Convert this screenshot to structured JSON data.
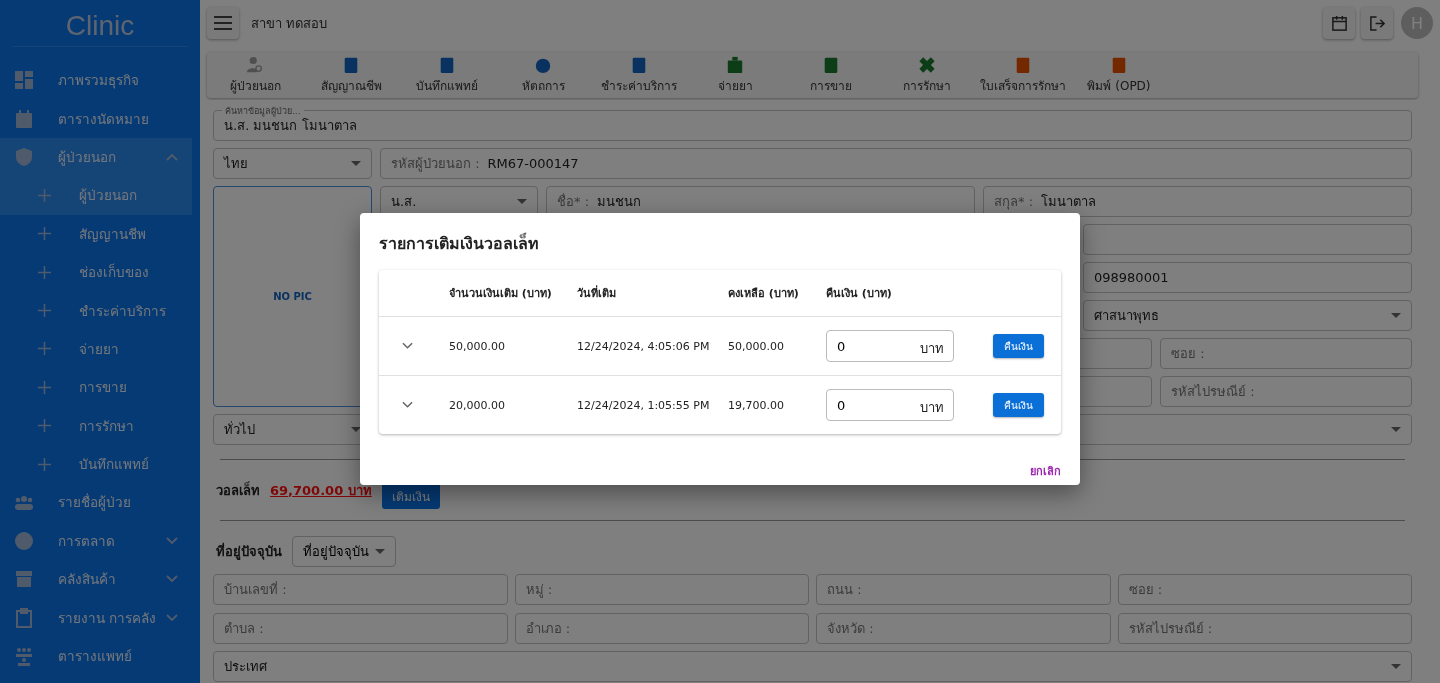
{
  "sidebar": {
    "title": "Clinic",
    "items": [
      {
        "label": "ภาพรวมธุรกิจ",
        "selected": false
      },
      {
        "label": "ตารางนัดหมาย",
        "selected": false
      },
      {
        "label": "ผู้ป่วยนอก",
        "selected": true,
        "expanded": true,
        "children": [
          {
            "label": "ผู้ป่วยนอก",
            "selected": true
          },
          {
            "label": "สัญญานชีพ",
            "selected": false
          },
          {
            "label": "ช่องเก็บของ",
            "selected": false
          },
          {
            "label": "ชำระค่าบริการ",
            "selected": false
          },
          {
            "label": "จ่ายยา",
            "selected": false
          },
          {
            "label": "การขาย",
            "selected": false
          },
          {
            "label": "การรักษา",
            "selected": false
          },
          {
            "label": "บันทึกแพทย์",
            "selected": false
          }
        ]
      },
      {
        "label": "รายชื่อผู้ป่วย",
        "selected": false
      },
      {
        "label": "การตลาด",
        "selected": false,
        "expanded": false
      },
      {
        "label": "คลังสินค้า",
        "selected": false,
        "expanded": false
      },
      {
        "label": "รายงาน การคลัง",
        "selected": false,
        "expanded": false
      },
      {
        "label": "ตารางแพทย์",
        "selected": false
      }
    ]
  },
  "topbar": {
    "branch": "สาขา ทดสอบ",
    "avatar": "H"
  },
  "toolbar": [
    {
      "label": "ผู้ป่วยนอก"
    },
    {
      "label": "สัญญาณชีพ"
    },
    {
      "label": "บันทึกแพทย์"
    },
    {
      "label": "หัตถการ"
    },
    {
      "label": "ชำระค่าบริการ"
    },
    {
      "label": "จ่ายยา"
    },
    {
      "label": "การขาย"
    },
    {
      "label": "การรักษา"
    },
    {
      "label": "ใบเสร็จการรักษา"
    },
    {
      "label": "พิมพ์ (OPD)"
    }
  ],
  "patient_form": {
    "search": {
      "label": "ค้นหาข้อมูลผู้ป่วย...",
      "value": "น.ส. มนชนก โมนาตาล"
    },
    "nationality": "ไทย",
    "patient_id": {
      "label": "รหัสผู้ป่วยนอก :",
      "value": "RM67-000147"
    },
    "photo": "NO PIC",
    "prefix": "น.ส.",
    "first_name": {
      "label": "ชื่อ* :",
      "value": "มนชนก"
    },
    "last_name": {
      "label": "สกุล* :",
      "value": "โมนาตาล"
    },
    "field_5": "098980001",
    "select_6": "ศาสนาพุทธ",
    "field_7": {
      "placeholder": "ซอย :"
    },
    "field_8": {
      "placeholder": "รหัสไปรษณีย์ :"
    },
    "patient_type": "ทั่วไป"
  },
  "wallet": {
    "label": "วอลเล็ท",
    "balance": "69,700.00 บาท",
    "button": "เติมเงิน"
  },
  "address": {
    "label": "ที่อยู่ปัจจุบัน",
    "dropdown": "ที่อยู่ปัจจุบัน",
    "fields": [
      {
        "placeholder": "บ้านเลขที่ :"
      },
      {
        "placeholder": "หมู่ :"
      },
      {
        "placeholder": "ถนน :"
      },
      {
        "placeholder": "ซอย :"
      },
      {
        "placeholder": "ตำบล :"
      },
      {
        "placeholder": "อำเภอ :"
      },
      {
        "placeholder": "จังหวัด :"
      },
      {
        "placeholder": "รหัสไปรษณีย์ :"
      }
    ],
    "country": "ประเทศ"
  },
  "dialog": {
    "title": "รายการเติมเงินวอลเล็ท",
    "columns": [
      "จำนวนเงินเติม (บาท)",
      "วันที่เติม",
      "คงเหลือ (บาท)",
      "คืนเงิน (บาท)"
    ],
    "rows": [
      {
        "amount": "50,000.00",
        "date": "12/24/2024, 4:05:06 PM",
        "balance": "50,000.00",
        "refund": "0",
        "unit": "บาท",
        "button": "คืนเงิน"
      },
      {
        "amount": "20,000.00",
        "date": "12/24/2024, 1:05:55 PM",
        "balance": "19,700.00",
        "refund": "0",
        "unit": "บาท",
        "button": "คืนเงิน"
      }
    ],
    "cancel": "ยกเลิก"
  }
}
